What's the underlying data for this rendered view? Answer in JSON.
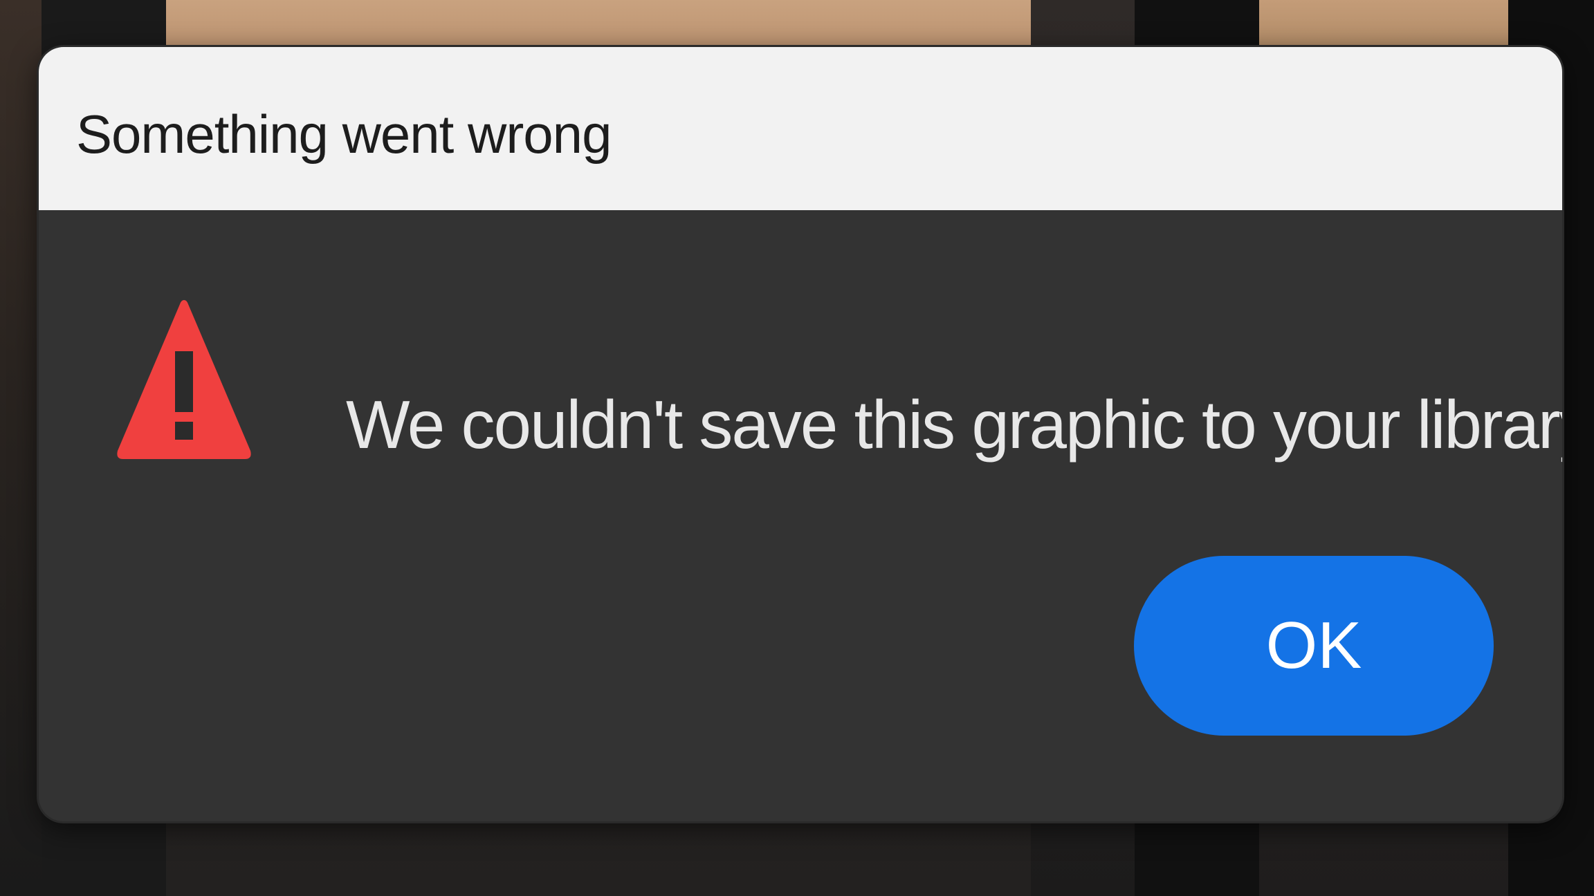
{
  "dialog": {
    "title": "Something went wrong",
    "message": "We couldn't save this graphic to your library.",
    "icon": "warning-icon",
    "ok_label": "OK"
  },
  "colors": {
    "dialog_body": "#333333",
    "title_bar": "#f2f2f2",
    "warning": "#f0403f",
    "button": "#1473e6"
  }
}
